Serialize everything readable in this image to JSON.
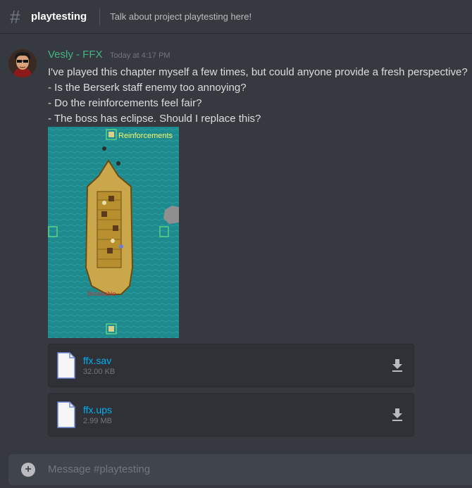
{
  "channel": {
    "name": "playtesting",
    "topic": "Talk about project playtesting here!"
  },
  "message": {
    "author": "Vesly - FFX",
    "author_color": "#43b581",
    "timestamp": "Today at 4:17 PM",
    "lines": [
      "I've played this chapter myself a few times, but could anyone provide a fresh perspective?",
      "- Is the Berserk staff enemy too annoying?",
      "- Do the reinforcements feel fair?",
      "- The boss has eclipse. Should I replace this?"
    ],
    "image": {
      "label_top": "Reinforcements",
      "label_bottom": "Breakable"
    }
  },
  "attachments": [
    {
      "name": "ffx.sav",
      "size": "32.00 KB"
    },
    {
      "name": "ffx.ups",
      "size": "2.99 MB"
    }
  ],
  "composer": {
    "placeholder": "Message #playtesting"
  }
}
